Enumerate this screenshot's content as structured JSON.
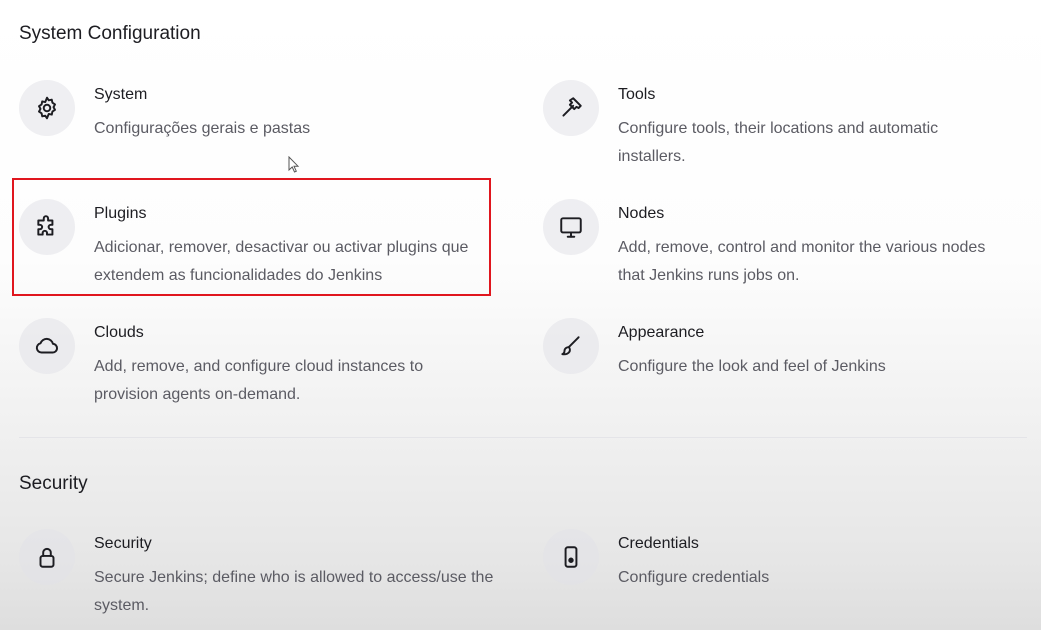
{
  "sections": [
    {
      "title": "System Configuration",
      "items": [
        {
          "title": "System",
          "description": "Configurações gerais e pastas",
          "icon": "gear-icon"
        },
        {
          "title": "Tools",
          "description": "Configure tools, their locations and automatic installers.",
          "icon": "hammer-icon"
        },
        {
          "title": "Plugins",
          "description": "Adicionar, remover, desactivar ou activar plugins que extendem as funcionalidades do Jenkins",
          "icon": "puzzle-icon"
        },
        {
          "title": "Nodes",
          "description": "Add, remove, control and monitor the various nodes that Jenkins runs jobs on.",
          "icon": "monitor-icon"
        },
        {
          "title": "Clouds",
          "description": "Add, remove, and configure cloud instances to provision agents on-demand.",
          "icon": "cloud-icon"
        },
        {
          "title": "Appearance",
          "description": "Configure the look and feel of Jenkins",
          "icon": "brush-icon"
        }
      ]
    },
    {
      "title": "Security",
      "items": [
        {
          "title": "Security",
          "description": "Secure Jenkins; define who is allowed to access/use the system.",
          "icon": "lock-icon"
        },
        {
          "title": "Credentials",
          "description": "Configure credentials",
          "icon": "phone-icon"
        }
      ]
    }
  ],
  "colors": {
    "highlight": "#e0161e",
    "text": "#1d1d22",
    "muted": "#5b5b63"
  }
}
